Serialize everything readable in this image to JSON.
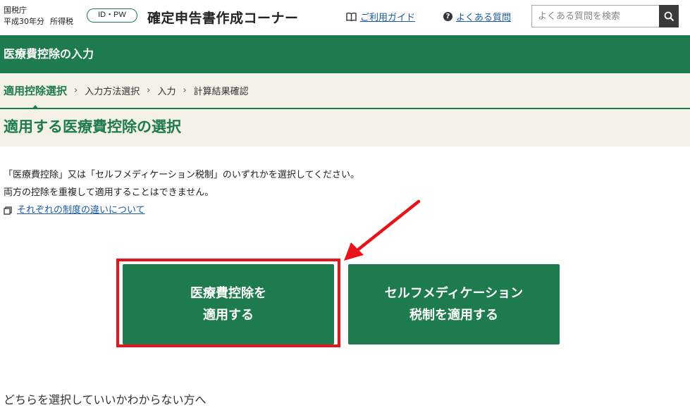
{
  "header": {
    "agency": "国税庁",
    "year": "平成30年分",
    "tax_type": "所得税",
    "id_pw_label": "ID・PW",
    "site_title": "確定申告書作成コーナー",
    "guide_link": "ご利用ガイド",
    "faq_link": "よくある質問",
    "search_placeholder": "よくある質問を検索"
  },
  "section": {
    "title": "医療費控除の入力"
  },
  "steps": [
    {
      "label": "適用控除選択",
      "current": true
    },
    {
      "label": "入力方法選択",
      "current": false
    },
    {
      "label": "入力",
      "current": false
    },
    {
      "label": "計算結果確認",
      "current": false
    }
  ],
  "page": {
    "heading": "適用する医療費控除の選択",
    "instruction_1": "「医療費控除」又は「セルフメディケーション税制」のいずれかを選択してください。",
    "instruction_2": "両方の控除を重複して適用することはできません。",
    "difference_link": "それぞれの制度の違いについて",
    "unsure_text": "どちらを選択していいかわからない方へ"
  },
  "buttons": {
    "medical": "医療費控除を\n適用する",
    "selfmed": "セルフメディケーション\n税制を適用する"
  },
  "colors": {
    "brand_green": "#1e7b4d",
    "beige": "#f3f1e8",
    "link_blue": "#1a5aa6",
    "highlight_red": "#e8141a"
  }
}
